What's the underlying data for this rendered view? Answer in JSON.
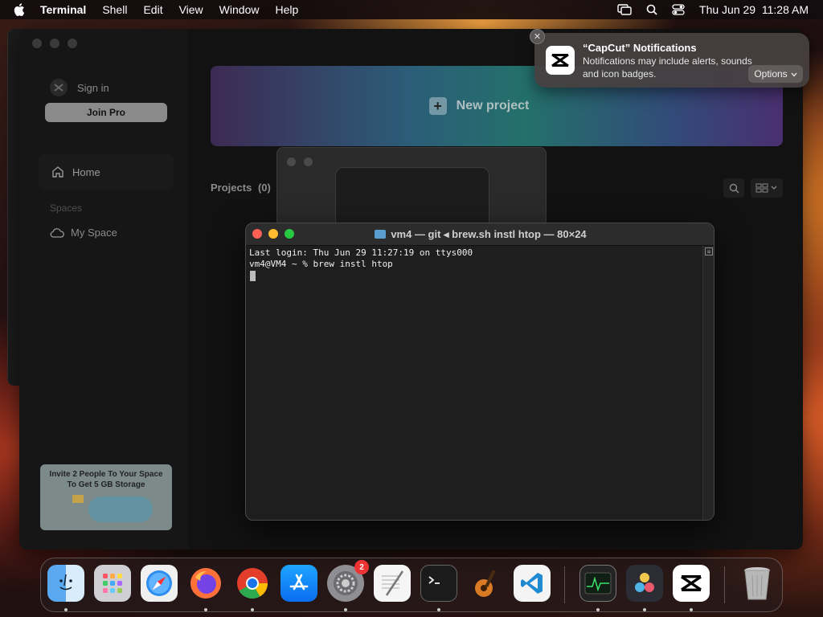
{
  "menubar": {
    "app_name": "Terminal",
    "menus": [
      "Shell",
      "Edit",
      "View",
      "Window",
      "Help"
    ],
    "clock": "Thu Jun 29  11:28 AM"
  },
  "capcut": {
    "sign_in": "Sign in",
    "join_pro": "Join Pro",
    "home": "Home",
    "spaces_label": "Spaces",
    "my_space": "My Space",
    "invite_text": "Invite 2 People To Your Space To Get 5 GB Storage",
    "new_project": "New project",
    "projects_label": "Projects",
    "projects_count": "(0)"
  },
  "terminal": {
    "title": "vm4 — git ◂ brew.sh instl htop — 80×24",
    "lines": [
      "Last login: Thu Jun 29 11:27:19 on ttys000",
      "vm4@VM4 ~ % brew instl htop"
    ]
  },
  "notification": {
    "title": "“CapCut” Notifications",
    "body": "Notifications may include alerts, sounds and icon badges.",
    "options": "Options"
  },
  "dock": {
    "items": [
      "Finder",
      "Launchpad",
      "Safari",
      "Firefox",
      "Chrome",
      "App Store",
      "System Settings",
      "TextEdit",
      "Terminal",
      "GarageBand",
      "Visual Studio Code",
      "Activity Monitor",
      "DaVinci Resolve",
      "CapCut",
      "Trash"
    ],
    "settings_badge": "2"
  },
  "colors": {
    "close": "#fe5f57",
    "minimize": "#febc2e",
    "zoom": "#28c840"
  }
}
